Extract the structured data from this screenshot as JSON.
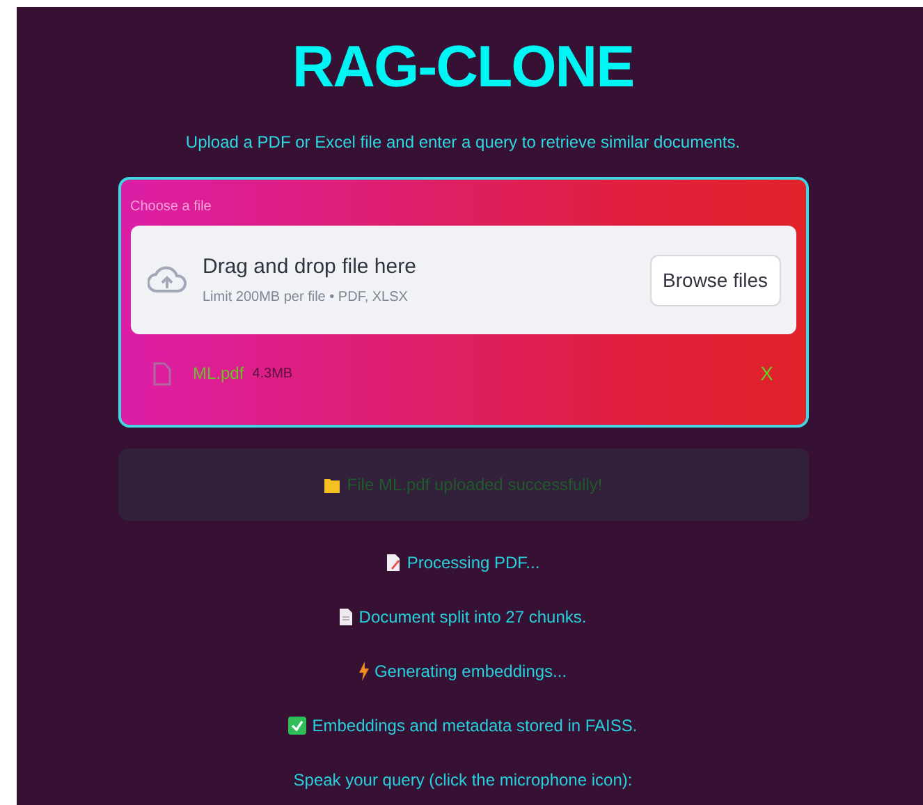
{
  "title": "RAG-CLONE",
  "subtitle": "Upload a PDF or Excel file and enter a query to retrieve similar documents.",
  "uploader": {
    "label": "Choose a file",
    "dropzone_title": "Drag and drop file here",
    "dropzone_hint": "Limit 200MB per file • PDF, XLSX",
    "browse_button": "Browse files",
    "file": {
      "name": "ML.pdf",
      "size": "4.3MB",
      "remove": "X"
    }
  },
  "success": {
    "kind": "folder",
    "text": "File ML.pdf uploaded successfully!"
  },
  "messages": [
    {
      "kind": "memo",
      "text": "Processing PDF..."
    },
    {
      "kind": "page",
      "text": "Document split into 27 chunks."
    },
    {
      "kind": "bolt",
      "text": "Generating embeddings..."
    },
    {
      "kind": "check",
      "text": "Embeddings and metadata stored in FAISS."
    },
    {
      "kind": "none",
      "text": "Speak your query (click the microphone icon):"
    }
  ]
}
